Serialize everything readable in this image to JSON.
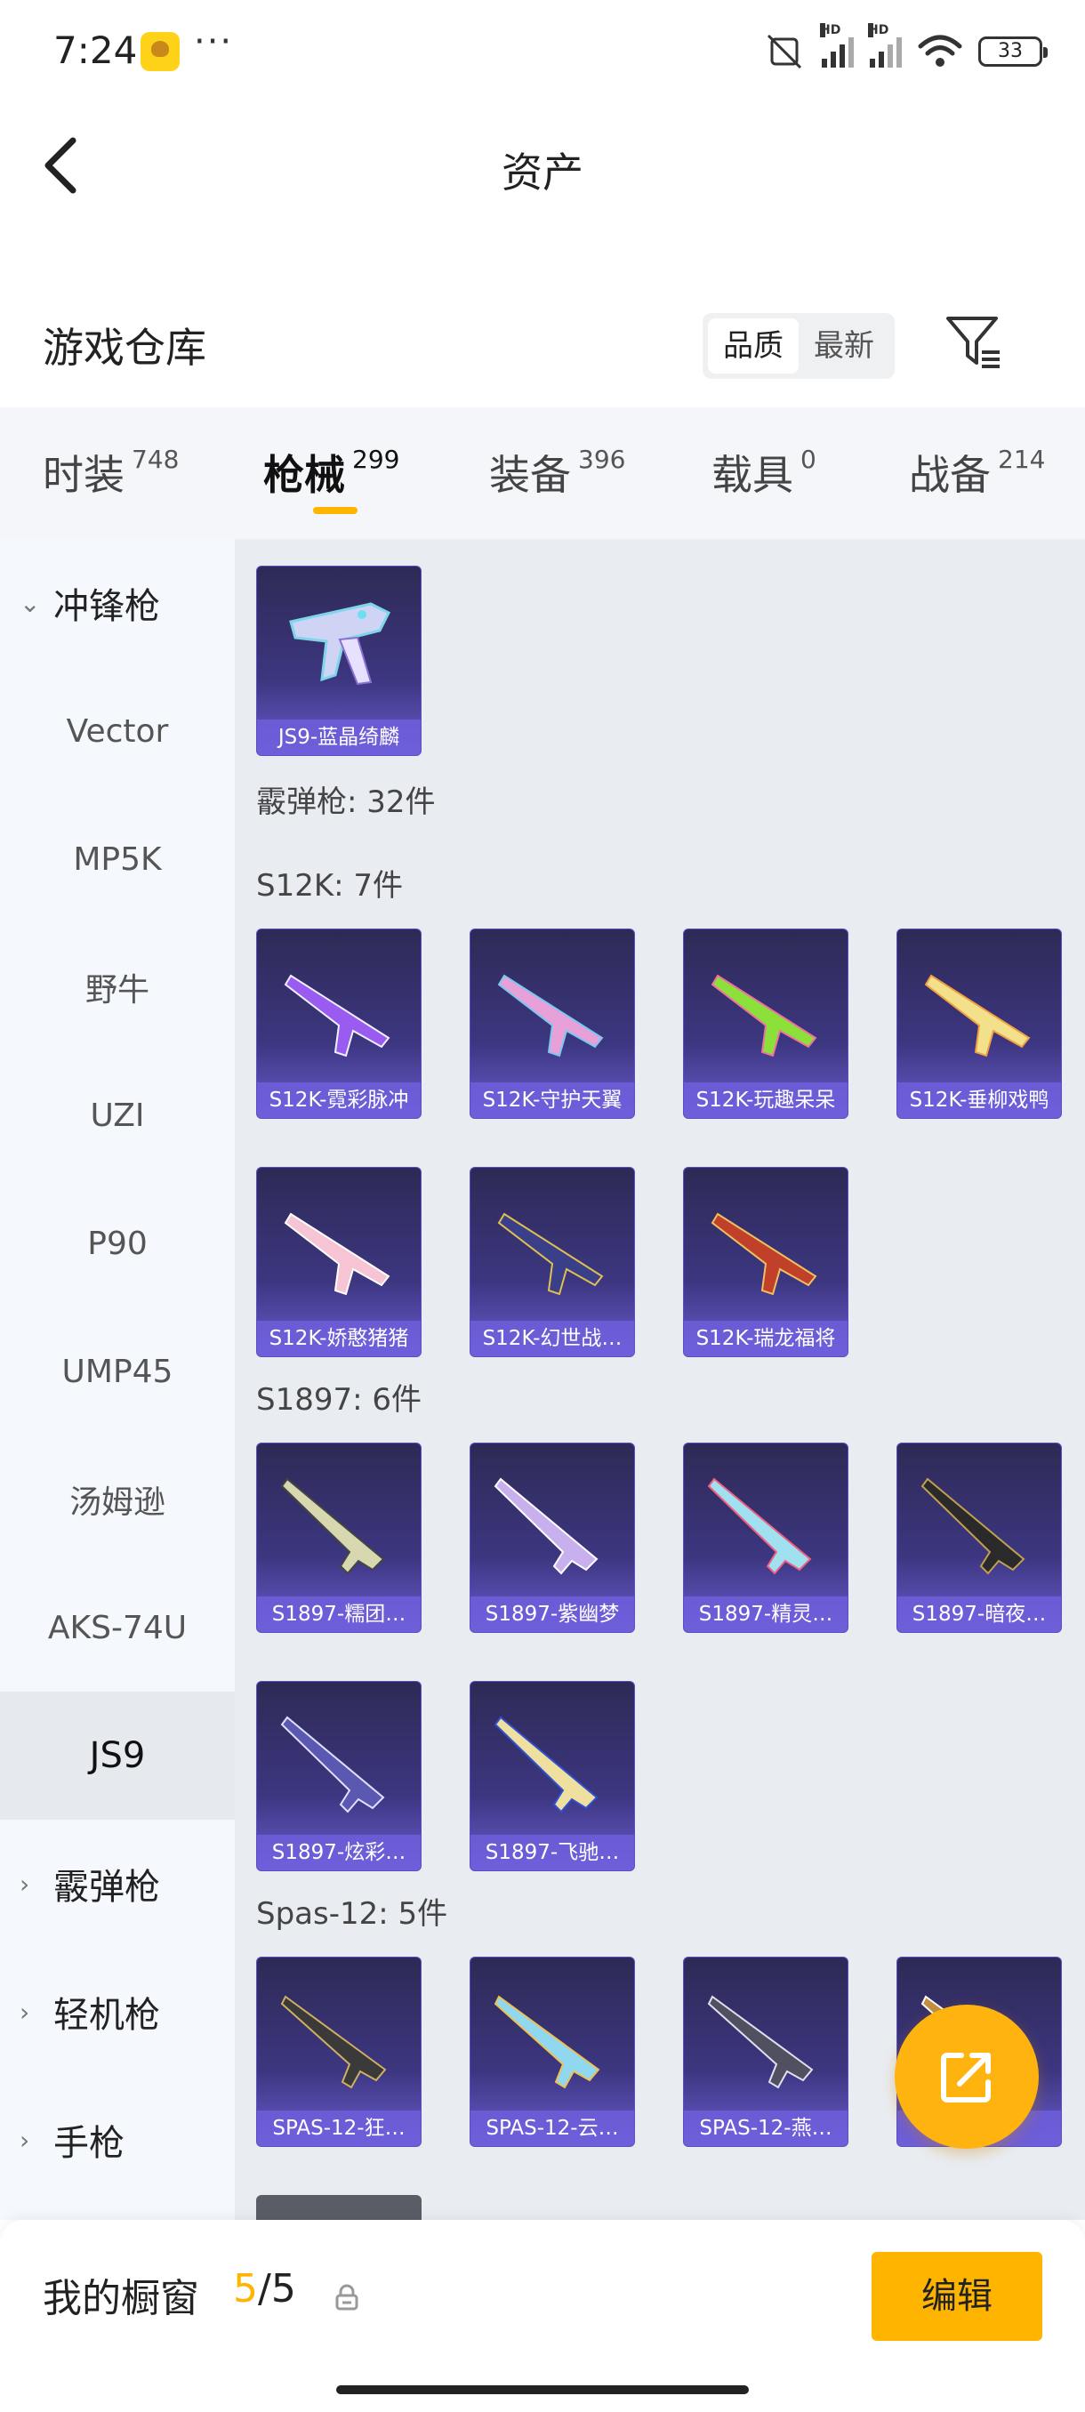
{
  "status_bar": {
    "time": "7:24",
    "dots": "···",
    "battery": "33",
    "hd1": "HD",
    "hd2": "HD"
  },
  "header": {
    "title": "资产"
  },
  "warehouse": {
    "title": "游戏仓库",
    "sort_options": [
      "品质",
      "最新"
    ],
    "active_sort": "品质"
  },
  "tabs": [
    {
      "label": "时装",
      "count": "748"
    },
    {
      "label": "枪械",
      "count": "299",
      "active": true
    },
    {
      "label": "装备",
      "count": "396"
    },
    {
      "label": "载具",
      "count": "0"
    },
    {
      "label": "战备",
      "count": "214"
    }
  ],
  "sidebar": {
    "items": [
      {
        "label": "冲锋枪",
        "type": "group",
        "expanded": true
      },
      {
        "label": "Vector"
      },
      {
        "label": "MP5K"
      },
      {
        "label": "野牛"
      },
      {
        "label": "UZI"
      },
      {
        "label": "P90"
      },
      {
        "label": "UMP45"
      },
      {
        "label": "汤姆逊"
      },
      {
        "label": "AKS-74U"
      },
      {
        "label": "JS9",
        "active": true
      },
      {
        "label": "霰弹枪",
        "type": "group"
      },
      {
        "label": "轻机枪",
        "type": "group"
      },
      {
        "label": "手枪",
        "type": "group"
      }
    ]
  },
  "content": {
    "js9_card": "JS9-蓝晶绮麟",
    "shotgun_total": "霰弹枪: 32件",
    "sections": [
      {
        "title": "S12K: 7件",
        "cards": [
          "S12K-霓彩脉冲",
          "S12K-守护天翼",
          "S12K-玩趣呆呆",
          "S12K-垂柳戏鸭",
          "S12K-娇憨猪猪",
          "S12K-幻世战…",
          "S12K-瑞龙福将"
        ]
      },
      {
        "title": "S1897: 6件",
        "cards": [
          "S1897-糯团…",
          "S1897-紫幽梦",
          "S1897-精灵…",
          "S1897-暗夜…",
          "S1897-炫彩…",
          "S1897-飞驰…"
        ]
      },
      {
        "title": "Spas-12: 5件",
        "cards": [
          "SPAS-12-狂…",
          "SPAS-12-云…",
          "SPAS-12-燕…",
          "…"
        ]
      }
    ]
  },
  "bottom_bar": {
    "label": "我的橱窗",
    "current": "5",
    "total": "/5",
    "edit_label": "编辑"
  },
  "colors": {
    "accent": "#ffb400",
    "card_bg": "#3c3680",
    "card_label_bg": "#6e5fdc"
  }
}
